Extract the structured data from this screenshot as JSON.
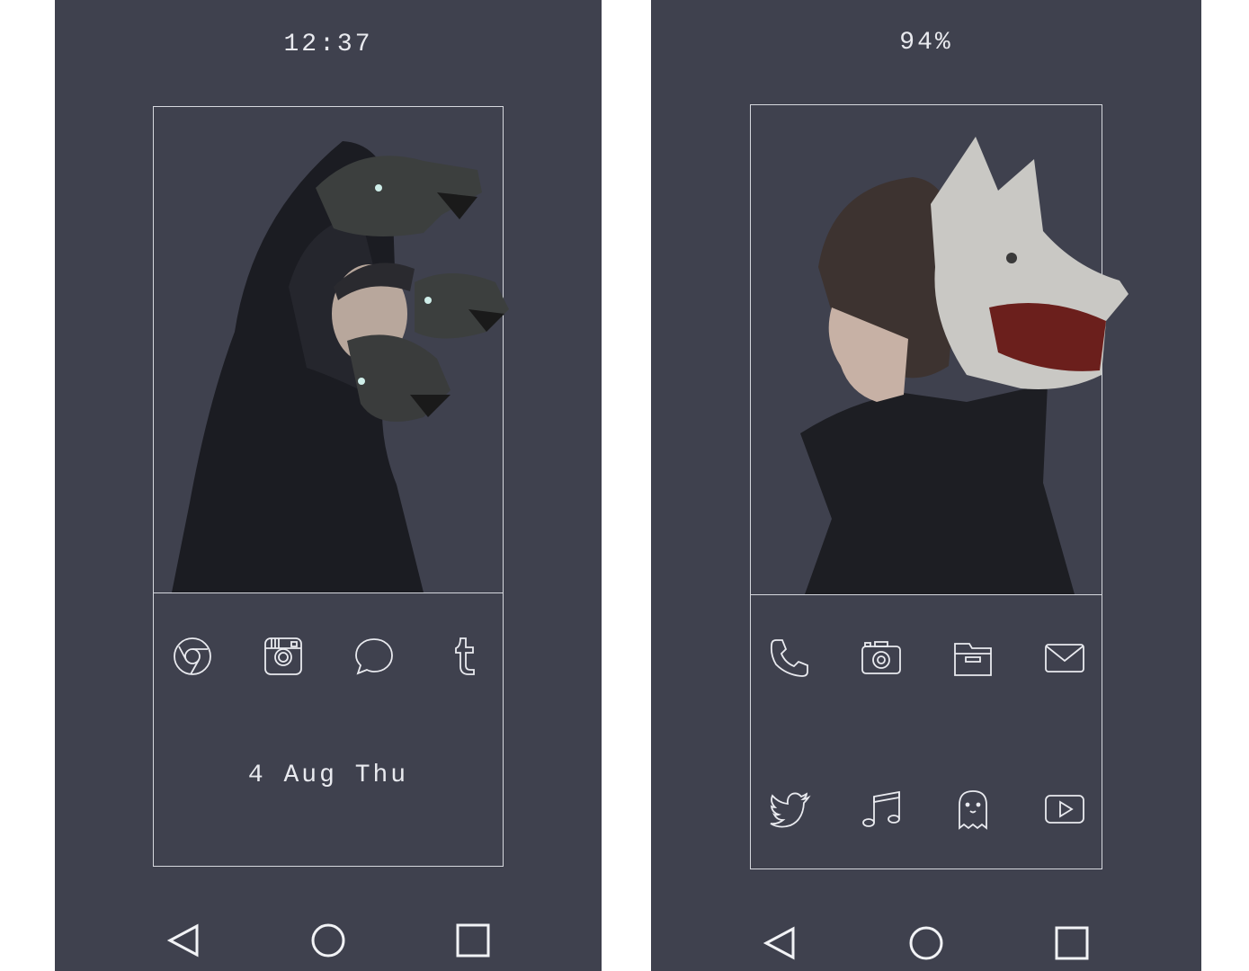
{
  "left_screen": {
    "clock": "12:37",
    "wallpaper": "wallpaper-hooded-figure-wolf-heads",
    "dock_icons": [
      "chrome-icon",
      "instagram-icon",
      "chat-bubble-icon",
      "tumblr-icon"
    ],
    "date": "4 Aug Thu",
    "nav": [
      "back-icon",
      "home-icon",
      "recents-icon"
    ]
  },
  "right_screen": {
    "battery": "94%",
    "wallpaper": "wallpaper-girl-wolf-mask",
    "dock_row1": [
      "phone-icon",
      "camera-icon",
      "folder-icon",
      "mail-icon"
    ],
    "dock_row2": [
      "twitter-icon",
      "music-icon",
      "ghost-icon",
      "youtube-icon"
    ],
    "nav": [
      "back-icon",
      "home-icon",
      "recents-icon"
    ]
  },
  "colors": {
    "screen_bg": "#3f414e",
    "line": "#d6d8de",
    "text": "#e9eaef"
  }
}
